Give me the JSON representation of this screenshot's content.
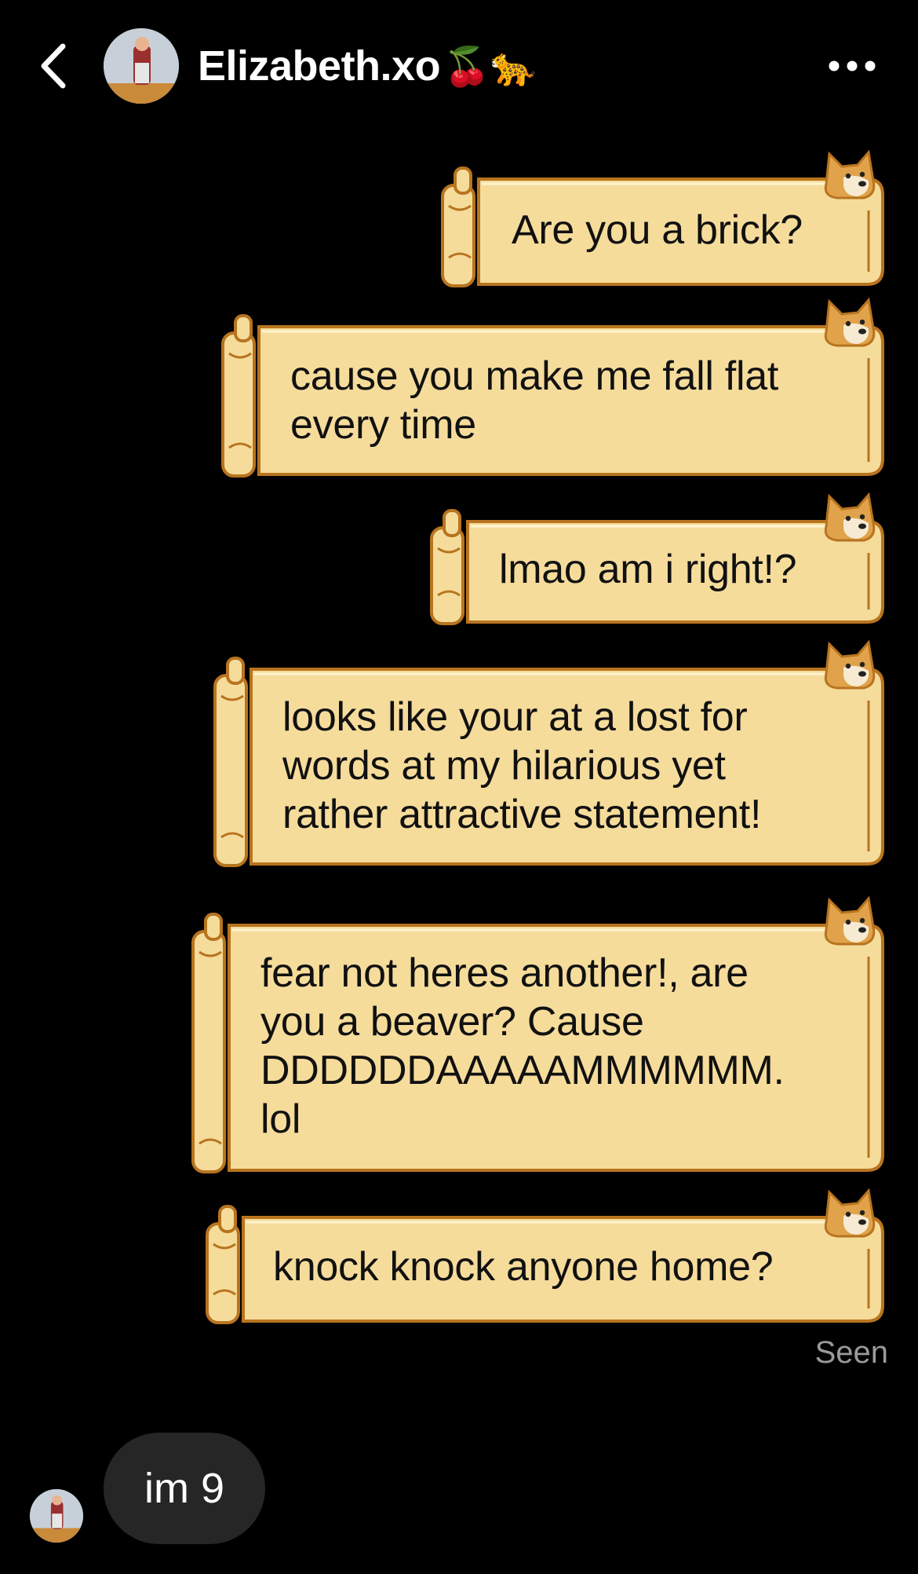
{
  "header": {
    "contact_name": "Elizabeth.xo",
    "name_emojis": "🍒🐆",
    "icons": {
      "back": "chevron-left-icon",
      "more": "more-horizontal-icon"
    }
  },
  "colors": {
    "background": "#000000",
    "scroll_fill": "#f6dc9b",
    "scroll_outline": "#b8741f",
    "received_bubble": "#262626",
    "seen_text": "#9a9a9a"
  },
  "messages": {
    "sent": [
      {
        "text": "Are you a brick?"
      },
      {
        "text": "cause you make me fall flat\nevery time"
      },
      {
        "text": "lmao am i right!?"
      },
      {
        "text": "looks like your at a lost for\nwords at my hilarious yet\nrather attractive statement!"
      },
      {
        "text": "fear not heres another!, are\nyou a beaver? Cause\nDDDDDDAAAAAMMMMMM.\nlol"
      },
      {
        "text": "knock knock anyone home?"
      }
    ],
    "seen_label": "Seen",
    "received": [
      {
        "text": "im 9"
      }
    ]
  }
}
